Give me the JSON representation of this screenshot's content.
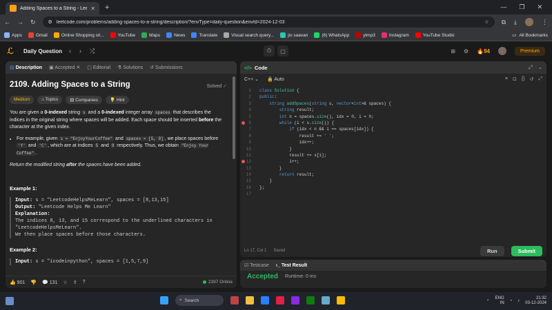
{
  "browser": {
    "tab_title": "Adding Spaces to a String - Lee",
    "url": "leetcode.com/problems/adding-spaces-to-a-string/description/?envType=daily-question&envId=2024-12-03",
    "bookmarks": [
      {
        "label": "Apps",
        "color": "#8ab4f8"
      },
      {
        "label": "Gmail",
        "color": "#ea4335"
      },
      {
        "label": "Online Shopping sit...",
        "color": "#f9ab00"
      },
      {
        "label": "YouTube",
        "color": "#ff0000"
      },
      {
        "label": "Maps",
        "color": "#34a853"
      },
      {
        "label": "News",
        "color": "#4285f4"
      },
      {
        "label": "Translate",
        "color": "#4285f4"
      },
      {
        "label": "Visual search query...",
        "color": "#aaaaaa"
      },
      {
        "label": "jio saavan",
        "color": "#2bc5b4"
      },
      {
        "label": "(6) WhatsApp",
        "color": "#25d366"
      },
      {
        "label": "ytmp3",
        "color": "#c00000"
      },
      {
        "label": "Instagram",
        "color": "#e1306c"
      },
      {
        "label": "YouTube Studio",
        "color": "#ff0000"
      }
    ],
    "all_bookmarks": "All Bookmarks"
  },
  "header": {
    "title": "Daily Question",
    "streak": "94",
    "premium": "Premium"
  },
  "left": {
    "tabs": [
      "Description",
      "Accepted",
      "Editorial",
      "Solutions",
      "Submissions"
    ],
    "problem_title": "2109. Adding Spaces to a String",
    "solved": "Solved",
    "chips": [
      "Medium",
      "Topics",
      "Companies",
      "Hint"
    ],
    "desc_1": "You are given a ",
    "desc_b1": "0-indexed",
    "desc_2": " string ",
    "desc_s": "s",
    "desc_3": " and a ",
    "desc_b2": "0-indexed",
    "desc_4": " integer array ",
    "desc_spaces": "spaces",
    "desc_5": " that describes the indices in the original string where spaces will be added. Each space should be inserted ",
    "desc_b3": "before",
    "desc_6": " the character at the given index.",
    "bullet_1": "For example, given ",
    "bullet_s": "s = \"EnjoyYourCoffee\"",
    "bullet_2": " and ",
    "bullet_sp": "spaces = [5, 9]",
    "bullet_3": ", we place spaces before ",
    "bullet_y": "'Y'",
    "bullet_4": " and ",
    "bullet_c": "'C'",
    "bullet_5": ", which are at indices ",
    "bullet_5v": "5",
    "bullet_6": " and ",
    "bullet_9v": "9",
    "bullet_7": " respectively. Thus, we obtain ",
    "bullet_r": "\"Enjoy Your Coffee\"",
    "bullet_8": ".",
    "note_1": "Return the modified string ",
    "note_b": "after",
    "note_2": " the spaces have been added.",
    "ex1_head": "Example 1:",
    "ex1_input_label": "Input:",
    "ex1_input": " s = \"LeetcodeHelpsMeLearn\", spaces = [8,13,15]",
    "ex1_output_label": "Output:",
    "ex1_output": " \"Leetcode Helps Me Learn\"",
    "ex1_expl_label": "Explanation:",
    "ex1_expl_1": "The indices 8, 13, and 15 correspond to the underlined characters in",
    "ex1_expl_2": "\"LeetcodeHelpsMeLearn\".",
    "ex1_expl_3": "We then place spaces before those characters.",
    "ex2_head": "Example 2:",
    "ex2_input_label": "Input:",
    "ex2_input": " s = \"icodeinpython\", spaces = [1,5,7,9]",
    "likes": "901",
    "comments": "131",
    "online": "2397 Online"
  },
  "code": {
    "title": "Code",
    "language": "C++",
    "auto": "Auto",
    "lines": [
      "class Solution {",
      "public:",
      "    string addSpaces(string s, vector<int>& spaces) {",
      "        string result;",
      "        int n = spaces.size(), idx = 0, i = 0;",
      "        while (i < s.size()) {",
      "            if (idx < n && i == spaces[idx]) {",
      "                result += ' ';",
      "                idx++;",
      "            }",
      "            result += s[i];",
      "            i++;",
      "        }",
      "        return result;",
      "    }",
      "};",
      ""
    ],
    "line_numbers": [
      "1",
      "2",
      "3",
      "4",
      "5",
      "6",
      "7",
      "8",
      "9",
      "10",
      "11",
      "12",
      "13",
      "14",
      "15",
      "16",
      "17"
    ],
    "status_pos": "Ln 17, Col 1",
    "status_saved": "Saved",
    "run": "Run",
    "submit": "Submit"
  },
  "tests": {
    "tab_testcase": "Testcase",
    "tab_result": "Test Result",
    "verdict": "Accepted",
    "runtime": "Runtime: 0 ms"
  },
  "taskbar": {
    "search": "Search",
    "lang_1": "ENG",
    "lang_2": "IN",
    "time": "21:32",
    "date": "03-12-2024"
  }
}
